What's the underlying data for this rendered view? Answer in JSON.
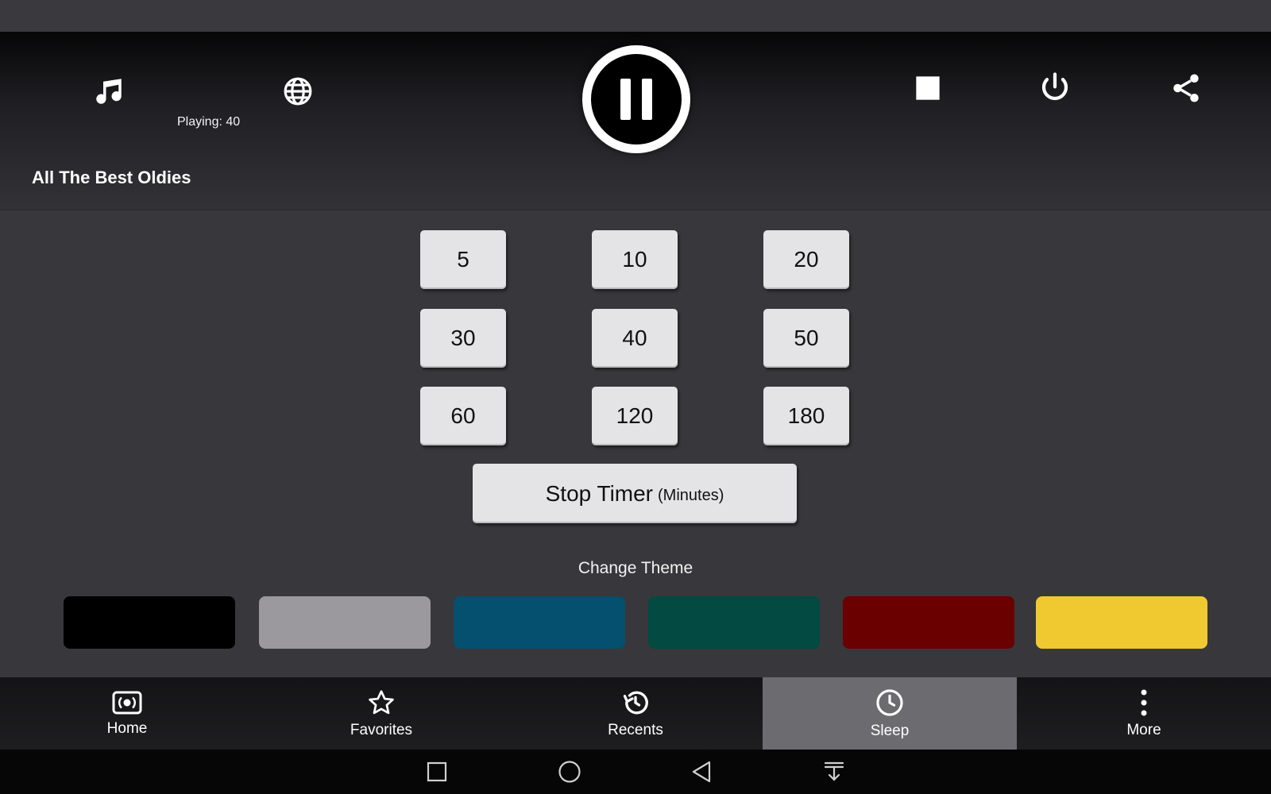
{
  "player": {
    "playing_text": "Playing: 40",
    "station_title": "All The Best Oldies"
  },
  "sleep": {
    "timer_options": [
      "5",
      "10",
      "20",
      "30",
      "40",
      "50",
      "60",
      "120",
      "180"
    ],
    "stop_timer_label": "Stop Timer",
    "stop_timer_unit": "(Minutes)"
  },
  "theme": {
    "label": "Change Theme",
    "colors": [
      "#000000",
      "#9b999d",
      "#054f6f",
      "#024a42",
      "#6a0000",
      "#f0c930"
    ]
  },
  "nav": {
    "items": [
      {
        "label": "Home",
        "icon": "radio-icon"
      },
      {
        "label": "Favorites",
        "icon": "star-icon"
      },
      {
        "label": "Recents",
        "icon": "history-icon"
      },
      {
        "label": "Sleep",
        "icon": "clock-icon",
        "active": true
      },
      {
        "label": "More",
        "icon": "more-vert-icon"
      }
    ]
  },
  "icons": {
    "top_bar": [
      "music-note-icon",
      "globe-icon",
      "pause-icon",
      "stop-icon",
      "power-icon",
      "share-icon"
    ],
    "system_nav": [
      "recent-apps-icon",
      "home-circle-icon",
      "back-icon",
      "notification-pull-icon"
    ]
  }
}
